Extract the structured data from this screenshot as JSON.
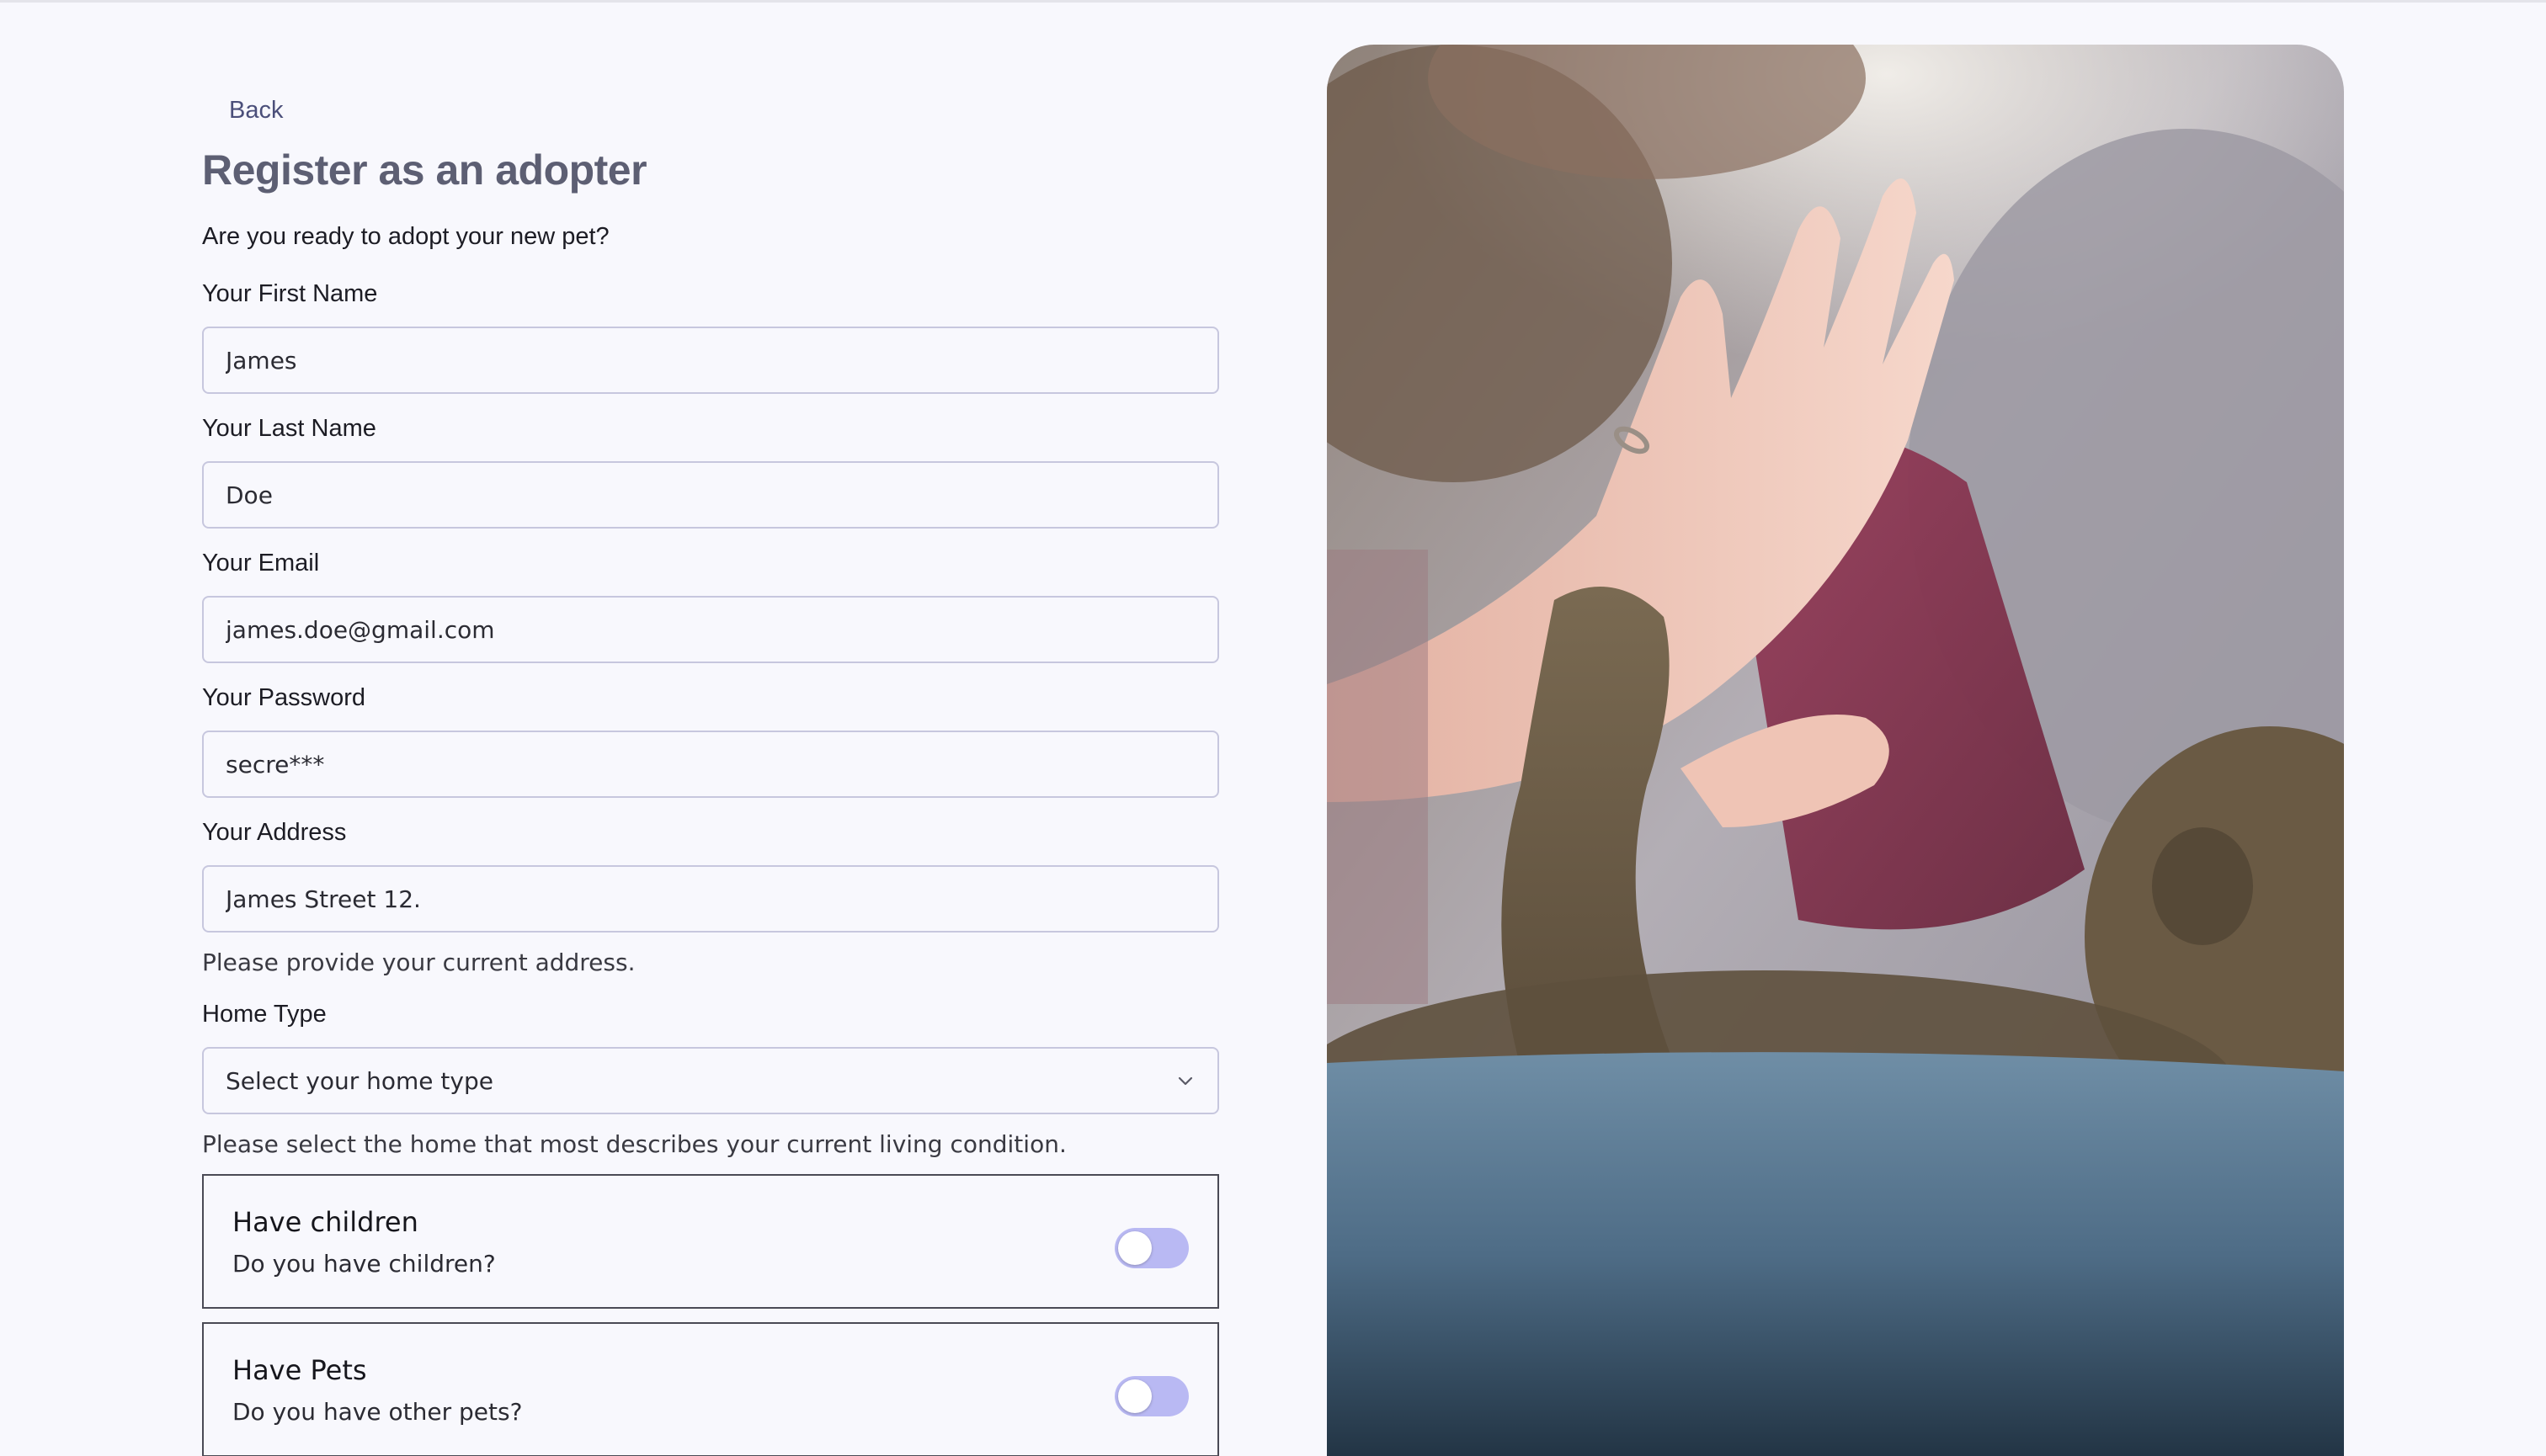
{
  "nav": {
    "back_label": "Back"
  },
  "header": {
    "title": "Register as an adopter",
    "subtitle": "Are you ready to adopt your new pet?"
  },
  "form": {
    "first_name": {
      "label": "Your First Name",
      "value": "James"
    },
    "last_name": {
      "label": "Your Last Name",
      "value": "Doe"
    },
    "email": {
      "label": "Your Email",
      "value": "james.doe@gmail.com"
    },
    "password": {
      "label": "Your Password",
      "value": "secre***"
    },
    "address": {
      "label": "Your Address",
      "value": "James Street 12.",
      "help": "Please provide your current address."
    },
    "home_type": {
      "label": "Home Type",
      "selected": "Select your home type",
      "help": "Please select the home that most describes your current living condition."
    },
    "toggles": [
      {
        "title": "Have children",
        "description": "Do you have children?",
        "on": false
      },
      {
        "title": "Have Pets",
        "description": "Do you have other pets?",
        "on": false
      }
    ]
  },
  "image": {
    "subject": "person high-fiving a tabby cat"
  },
  "colors": {
    "background": "#f8f8fd",
    "accent": "#b9b9f3",
    "title": "#5d5f73",
    "link": "#4b4f7a"
  }
}
